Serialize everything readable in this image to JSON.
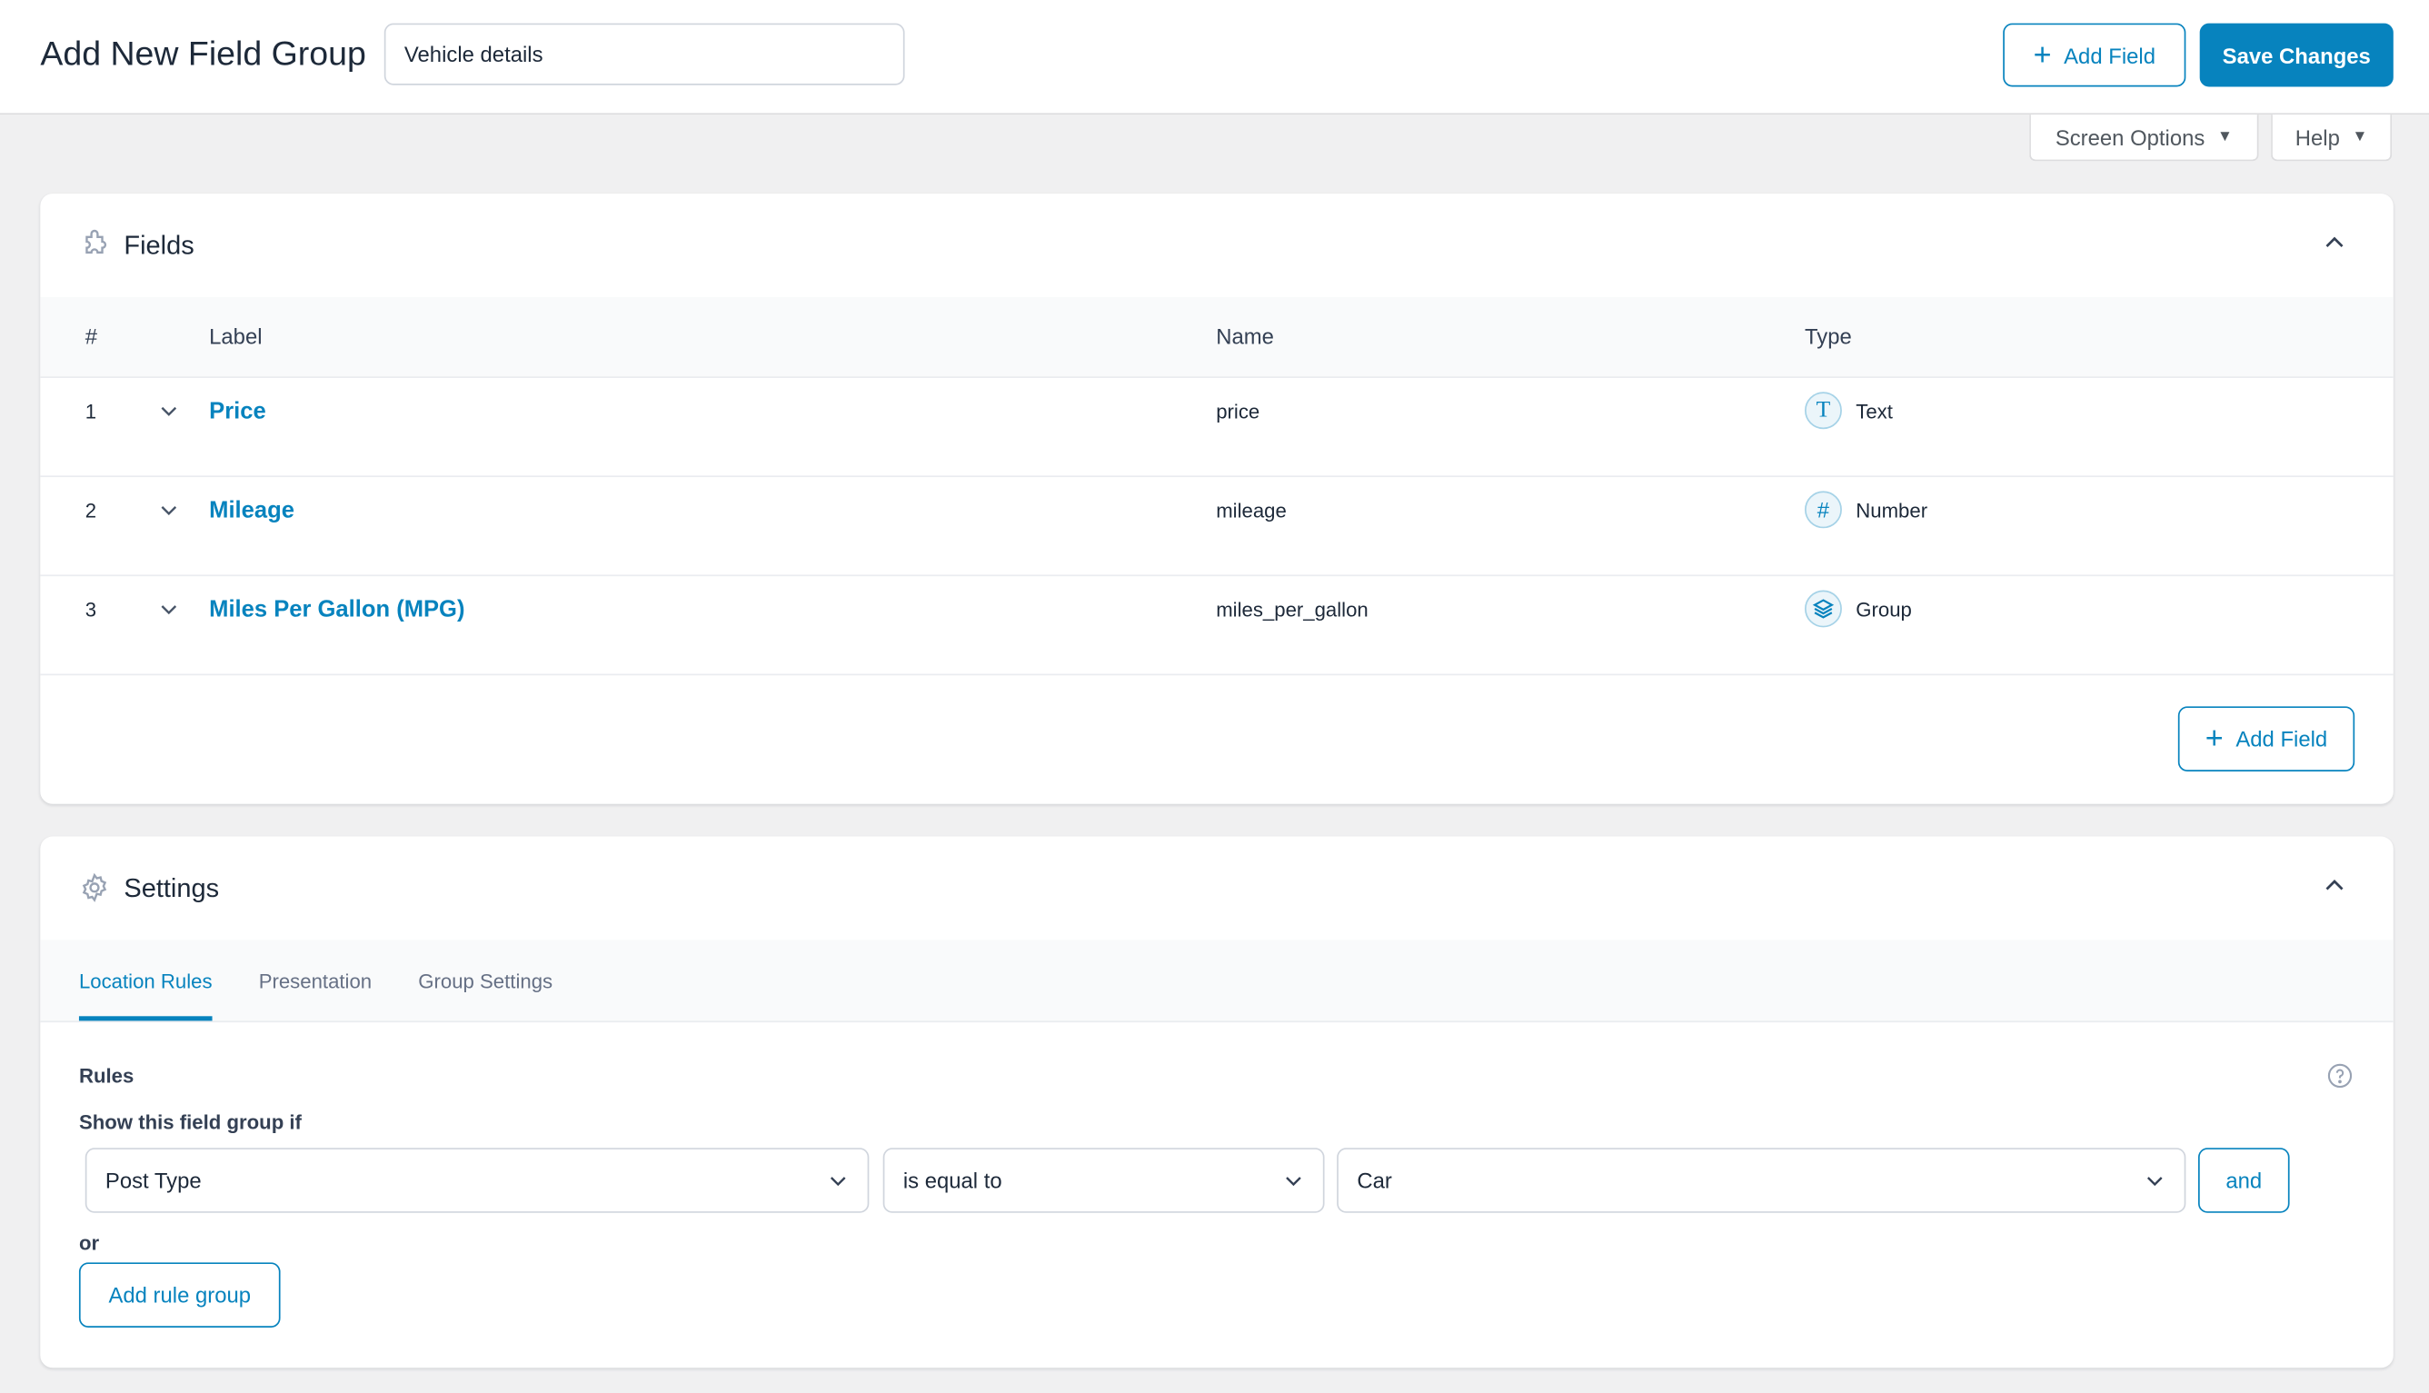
{
  "header": {
    "title": "Add New Field Group",
    "group_name_value": "Vehicle details",
    "add_field_label": "Add Field",
    "save_label": "Save Changes"
  },
  "screen_tabs": {
    "screen_options": "Screen Options",
    "help": "Help"
  },
  "fields_panel": {
    "title": "Fields",
    "columns": {
      "num": "#",
      "label": "Label",
      "name": "Name",
      "type": "Type"
    },
    "rows": [
      {
        "num": "1",
        "label": "Price",
        "name": "price",
        "type": "Text",
        "icon": "text-type-icon"
      },
      {
        "num": "2",
        "label": "Mileage",
        "name": "mileage",
        "type": "Number",
        "icon": "number-type-icon"
      },
      {
        "num": "3",
        "label": "Miles Per Gallon (MPG)",
        "name": "miles_per_gallon",
        "type": "Group",
        "icon": "group-type-icon"
      }
    ],
    "add_field_label": "Add Field"
  },
  "settings_panel": {
    "title": "Settings",
    "tabs": [
      "Location Rules",
      "Presentation",
      "Group Settings"
    ],
    "rules_label": "Rules",
    "show_if_label": "Show this field group if",
    "rule": {
      "param": "Post Type",
      "operator": "is equal to",
      "value": "Car",
      "and_label": "and"
    },
    "or_label": "or",
    "add_rule_group_label": "Add rule group"
  },
  "colors": {
    "accent": "#0783be",
    "background": "#f0f0f1"
  }
}
